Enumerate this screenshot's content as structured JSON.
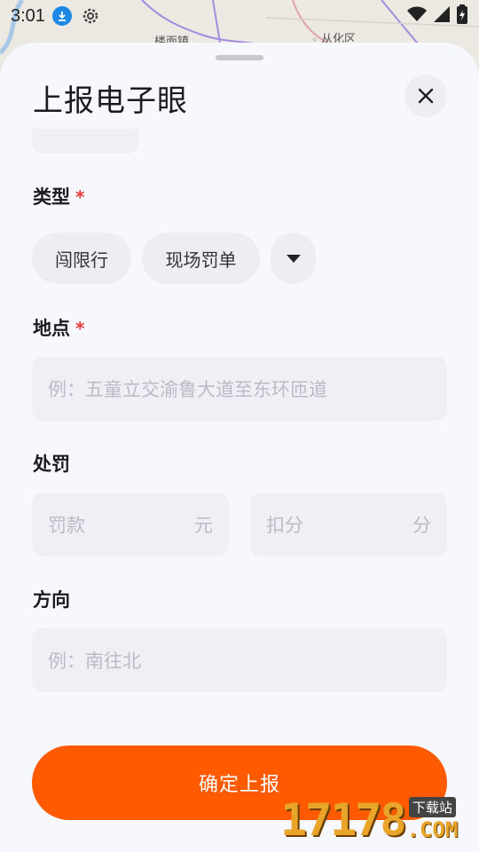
{
  "status_bar": {
    "time": "3:01"
  },
  "map": {
    "labels": [
      "楼面镇",
      "从化区"
    ]
  },
  "sheet": {
    "title": "上报电子眼",
    "close_icon": "close-icon"
  },
  "type_section": {
    "label": "类型",
    "required_mark": "*",
    "chips": [
      "闯限行",
      "现场罚单"
    ],
    "expand_icon": "triangle-down-icon"
  },
  "location_section": {
    "label": "地点",
    "required_mark": "*",
    "placeholder": "例：五童立交渝鲁大道至东环匝道"
  },
  "penalty_section": {
    "label": "处罚",
    "fine_placeholder": "罚款",
    "fine_unit": "元",
    "points_placeholder": "扣分",
    "points_unit": "分"
  },
  "direction_section": {
    "label": "方向",
    "placeholder": "例：南往北"
  },
  "submit": {
    "label": "确定上报"
  },
  "watermark": {
    "number": "17178",
    "tag": "下载站",
    "suffix": ".COM"
  },
  "colors": {
    "accent": "#ff5a00",
    "required": "#e53935",
    "sheet_bg": "#f6f8fd",
    "field_bg": "#eef0f5"
  }
}
